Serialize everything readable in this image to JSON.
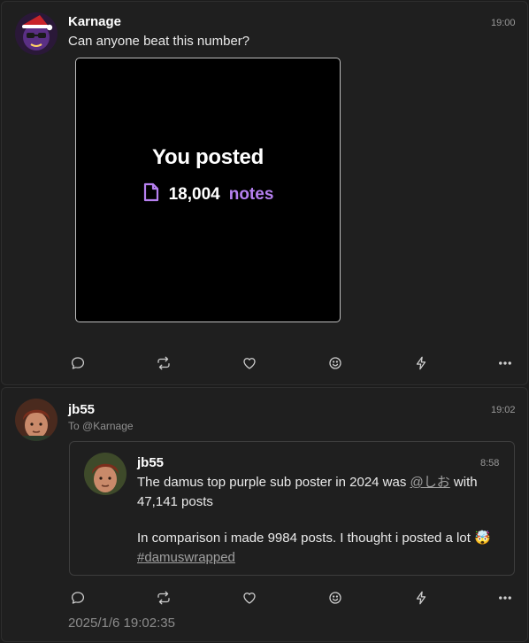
{
  "post1": {
    "author": "Karnage",
    "time": "19:00",
    "content": "Can anyone beat this number?",
    "media": {
      "headline": "You posted",
      "count": "18,004",
      "unit": "notes",
      "icon": "document-icon",
      "accent": "#b680f0"
    }
  },
  "post2": {
    "author": "jb55",
    "time": "19:02",
    "reply_to": "To @Karnage",
    "quoted": {
      "author": "jb55",
      "time": "8:58",
      "line1_pre": "The damus top purple sub poster in 2024 was ",
      "mention": "@しお",
      "line1_post": " with",
      "line2": "47,141 posts",
      "line3": "In comparison i made 9984 posts. I thought i posted a lot",
      "emoji": "🤯",
      "hashtag": "#damuswrapped"
    },
    "date": "2025/1/6 19:02:35"
  },
  "actions": [
    "reply-icon",
    "repost-icon",
    "like-icon",
    "react-icon",
    "zap-icon",
    "more-icon"
  ]
}
